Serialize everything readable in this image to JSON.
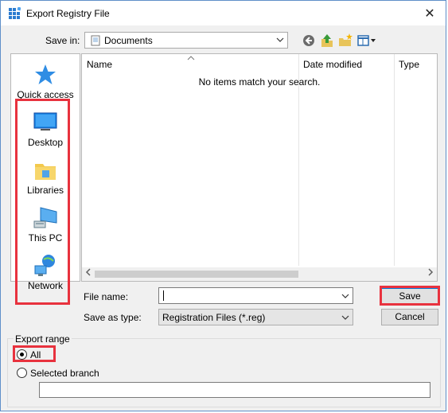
{
  "window": {
    "title": "Export Registry File"
  },
  "toolbar": {
    "save_in_label": "Save in:",
    "save_in_value": "Documents"
  },
  "places": [
    {
      "label": "Quick access",
      "icon": "star-icon"
    },
    {
      "label": "Desktop",
      "icon": "desktop-icon"
    },
    {
      "label": "Libraries",
      "icon": "libraries-icon"
    },
    {
      "label": "This PC",
      "icon": "computer-icon"
    },
    {
      "label": "Network",
      "icon": "network-icon"
    }
  ],
  "filelist": {
    "columns": [
      "Name",
      "Date modified",
      "Type"
    ],
    "empty_message": "No items match your search."
  },
  "form": {
    "file_name_label": "File name:",
    "file_name_value": "",
    "save_as_type_label": "Save as type:",
    "save_as_type_value": "Registration Files (*.reg)"
  },
  "buttons": {
    "save": "Save",
    "cancel": "Cancel"
  },
  "export_range": {
    "title": "Export range",
    "options": [
      "All",
      "Selected branch"
    ],
    "selected": "All",
    "branch_value": ""
  },
  "colors": {
    "highlight": "#e8323e",
    "accent": "#0078d7"
  }
}
